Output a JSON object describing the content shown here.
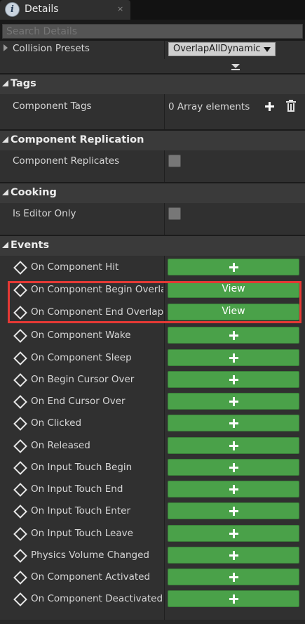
{
  "tab": {
    "title": "Details",
    "close": "×",
    "icon": "info-icon",
    "icon_glyph": "i"
  },
  "search": {
    "placeholder": "Search Details",
    "value": ""
  },
  "collision": {
    "label": "Collision Presets",
    "value": "OverlapAllDynamic"
  },
  "tags": {
    "title": "Tags",
    "component_tags_label": "Component Tags",
    "array_value": "0 Array elements"
  },
  "replication": {
    "title": "Component Replication",
    "label": "Component Replicates",
    "checked": false
  },
  "cooking": {
    "title": "Cooking",
    "label": "Is Editor Only",
    "checked": false
  },
  "events": {
    "title": "Events",
    "items": [
      {
        "label": "On Component Hit",
        "action": "add"
      },
      {
        "label": "On Component Begin Overlap",
        "action": "view",
        "button_label": "View"
      },
      {
        "label": "On Component End Overlap",
        "action": "view",
        "button_label": "View"
      },
      {
        "label": "On Component Wake",
        "action": "add"
      },
      {
        "label": "On Component Sleep",
        "action": "add"
      },
      {
        "label": "On Begin Cursor Over",
        "action": "add"
      },
      {
        "label": "On End Cursor Over",
        "action": "add"
      },
      {
        "label": "On Clicked",
        "action": "add"
      },
      {
        "label": "On Released",
        "action": "add"
      },
      {
        "label": "On Input Touch Begin",
        "action": "add"
      },
      {
        "label": "On Input Touch End",
        "action": "add"
      },
      {
        "label": "On Input Touch Enter",
        "action": "add"
      },
      {
        "label": "On Input Touch Leave",
        "action": "add"
      },
      {
        "label": "Physics Volume Changed",
        "action": "add"
      },
      {
        "label": "On Component Activated",
        "action": "add"
      },
      {
        "label": "On Component Deactivated",
        "action": "add"
      }
    ]
  },
  "colors": {
    "event_button": "#4aa149",
    "highlight": "#e53935",
    "panel": "#303030",
    "section_header": "#3a3a3a"
  }
}
